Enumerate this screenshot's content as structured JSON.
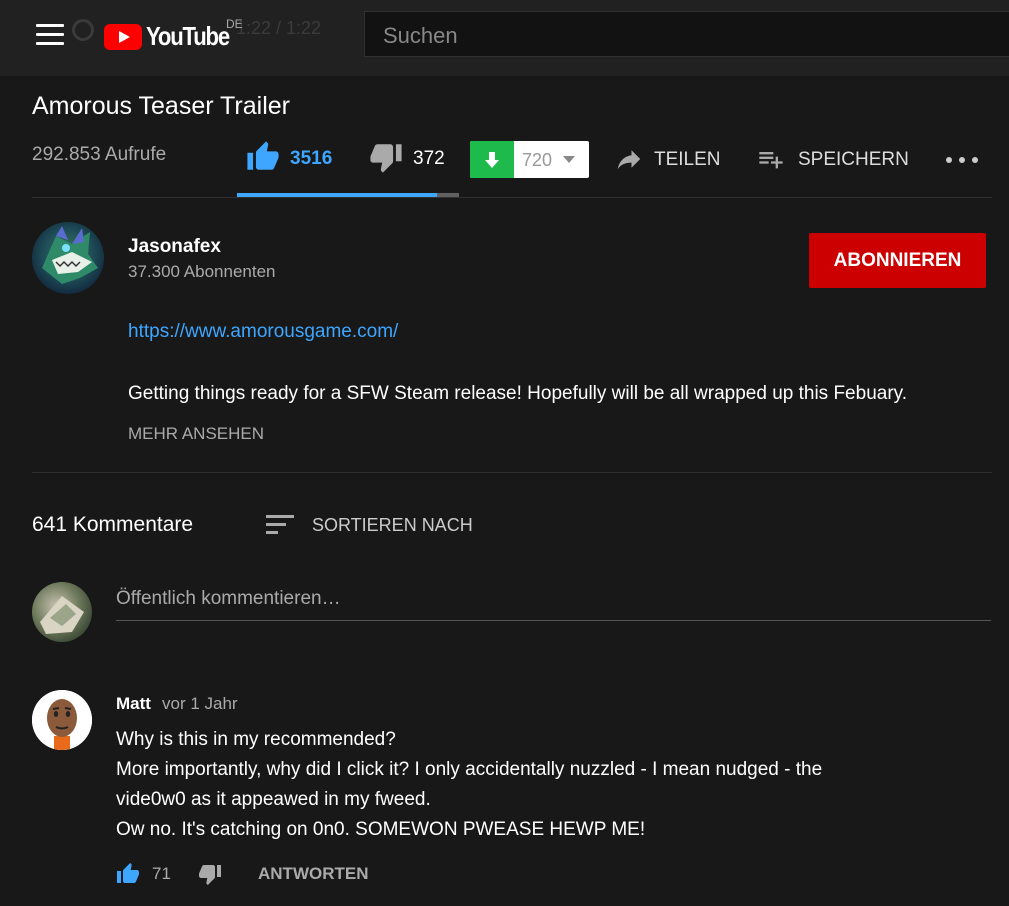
{
  "header": {
    "logo_text": "YouTube",
    "country_code": "DE",
    "ghost_time": "1:22 / 1:22",
    "search_placeholder": "Suchen"
  },
  "video": {
    "title": "Amorous Teaser Trailer",
    "views": "292.853 Aufrufe",
    "likes": "3516",
    "dislikes": "372",
    "like_ratio": 0.9,
    "extension_dislikes": "720",
    "share_label": "TEILEN",
    "save_label": "SPEICHERN"
  },
  "channel": {
    "name": "Jasonafex",
    "subscribers": "37.300 Abonnenten",
    "subscribe_label": "ABONNIEREN"
  },
  "description": {
    "link": "https://www.amorousgame.com/",
    "text": "Getting things ready for a SFW Steam release! Hopefully will be all wrapped up this Febuary.",
    "show_more": "MEHR ANSEHEN"
  },
  "comments": {
    "count_label": "641 Kommentare",
    "sort_label": "SORTIEREN NACH",
    "input_placeholder": "Öffentlich kommentieren…",
    "items": [
      {
        "author": "Matt",
        "time": "vor 1 Jahr",
        "lines": [
          "Why is this in my recommended?",
          "More importantly, why did I click it? I only accidentally nuzzled - I mean nudged - the",
          "vide0w0 as it appeawed in my fweed.",
          "Ow no. It's catching on 0n0. SOMEWON PWEASE HEWP ME!"
        ],
        "likes": "71",
        "reply_label": "ANTWORTEN"
      }
    ]
  },
  "colors": {
    "accent_blue": "#3ea6ff",
    "subscribe_red": "#cc0000",
    "extension_green": "#1ebb4c"
  }
}
